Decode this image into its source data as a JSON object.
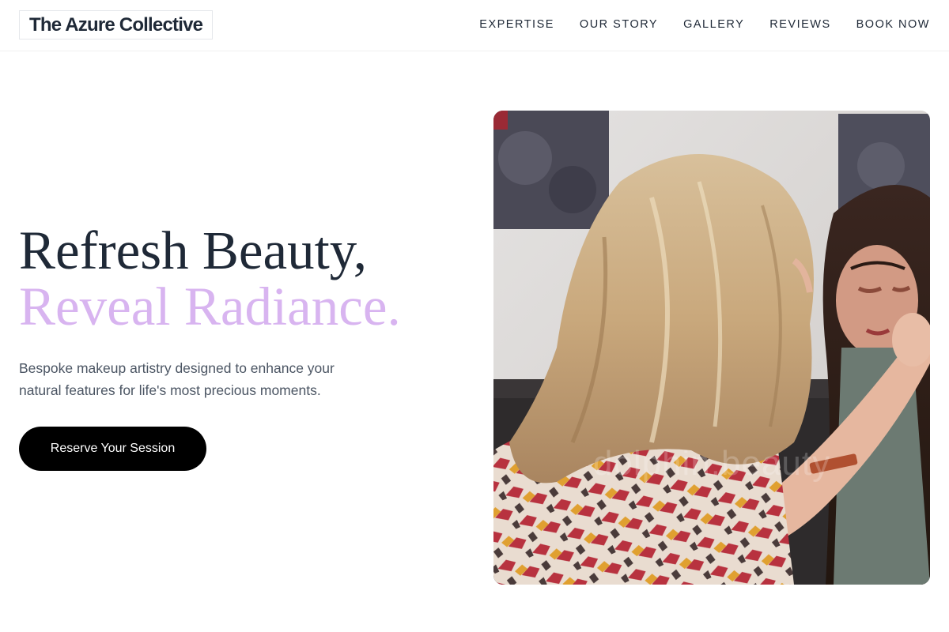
{
  "brand": {
    "name": "The Azure Collective"
  },
  "nav": {
    "items": [
      {
        "label": "EXPERTISE"
      },
      {
        "label": "OUR STORY"
      },
      {
        "label": "GALLERY"
      },
      {
        "label": "REVIEWS"
      },
      {
        "label": "BOOK NOW"
      }
    ]
  },
  "hero": {
    "heading_line1": "Refresh Beauty,",
    "heading_line2": "Reveal Radiance.",
    "subtitle": "Bespoke makeup artistry designed to enhance your natural features for life's most precious moments.",
    "cta_label": "Reserve Your Session",
    "image": {
      "watermark": "dolphin.beauty"
    }
  },
  "colors": {
    "accent": "#d8b4f0",
    "text_dark": "#1f2937",
    "text_muted": "#4b5563",
    "button_bg": "#000000"
  }
}
